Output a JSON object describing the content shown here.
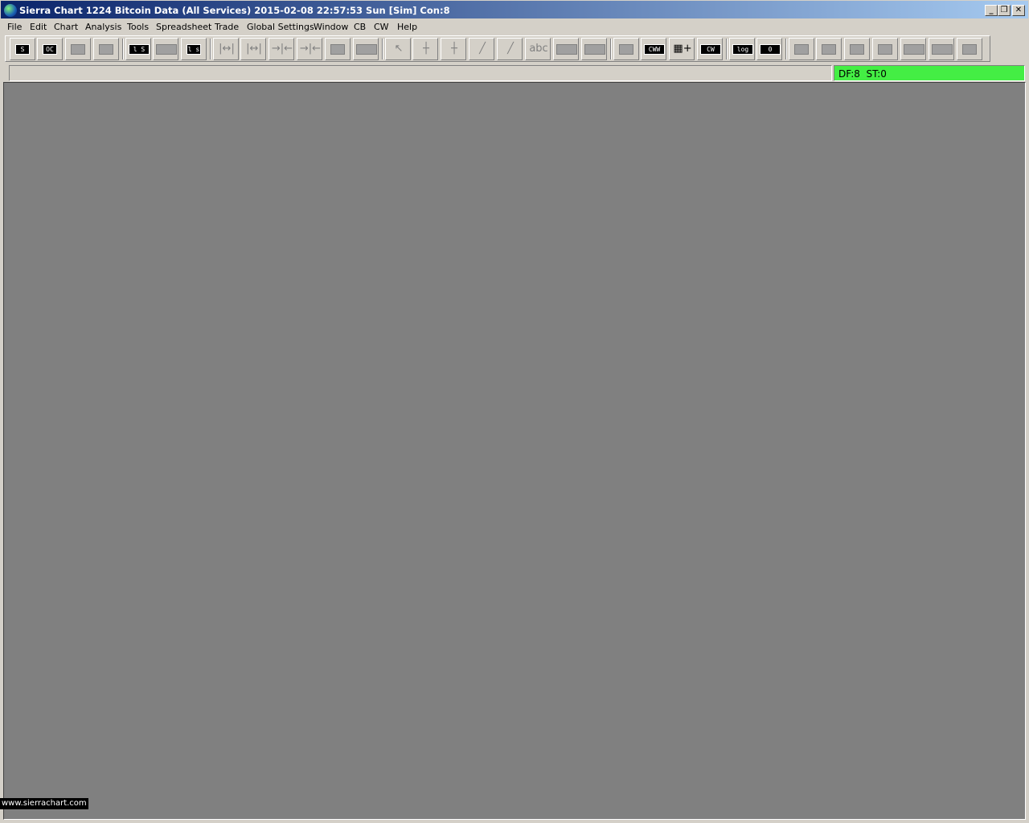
{
  "window": {
    "title": "Sierra Chart 1224 Bitcoin Data (All Services) 2015-02-08  22:57:53 Sun [Sim]  Con:8",
    "minimize_label": "_",
    "maximize_label": "❐",
    "close_label": "✕"
  },
  "menu": {
    "items": [
      "File",
      "Edit",
      "Chart",
      "Analysis",
      "Tools",
      "Spreadsheet",
      "Trade",
      "Global Settings",
      "Window",
      "CB",
      "CW",
      "Help"
    ]
  },
  "toolbar": {
    "labels": {
      "b0": "S",
      "b1": "OC",
      "b4": "l S",
      "b6": "l s",
      "b19": "abc",
      "b23": "CWW",
      "b24": "CW",
      "b25": "log",
      "b26": "0"
    },
    "glyphs": {
      "b7": "|↔|",
      "b8": "|↔|",
      "b9": "→|←",
      "b10": "→|←",
      "b13": "↖",
      "b14": "┼",
      "b15": "┼",
      "b16": "╱",
      "b17": "╱",
      "b22": "▦+"
    }
  },
  "status": {
    "left_text": "",
    "right_text": "DF:8  ST:0",
    "right_color": "#44ee44"
  },
  "workspace": {
    "background": "#808080",
    "website": "www.sierrachart.com"
  }
}
